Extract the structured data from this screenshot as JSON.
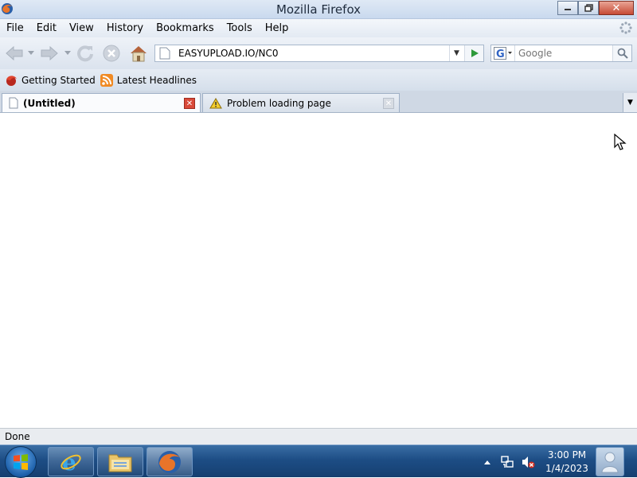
{
  "window": {
    "title": "Mozilla Firefox"
  },
  "menu": {
    "items": [
      "File",
      "Edit",
      "View",
      "History",
      "Bookmarks",
      "Tools",
      "Help"
    ]
  },
  "navbar": {
    "url": "EASYUPLOAD.IO/NC0",
    "search_placeholder": "Google"
  },
  "bookmarks": {
    "items": [
      "Getting Started",
      "Latest Headlines"
    ]
  },
  "tabs": [
    {
      "label": "(Untitled)",
      "active": true
    },
    {
      "label": "Problem loading page",
      "active": false
    }
  ],
  "status": {
    "text": "Done"
  },
  "taskbar": {
    "time": "3:00 PM",
    "date": "1/4/2023"
  },
  "colors": {
    "taskbar": "#1d4d85",
    "close_button": "#c64a35",
    "go_arrow": "#2e9a3a"
  }
}
